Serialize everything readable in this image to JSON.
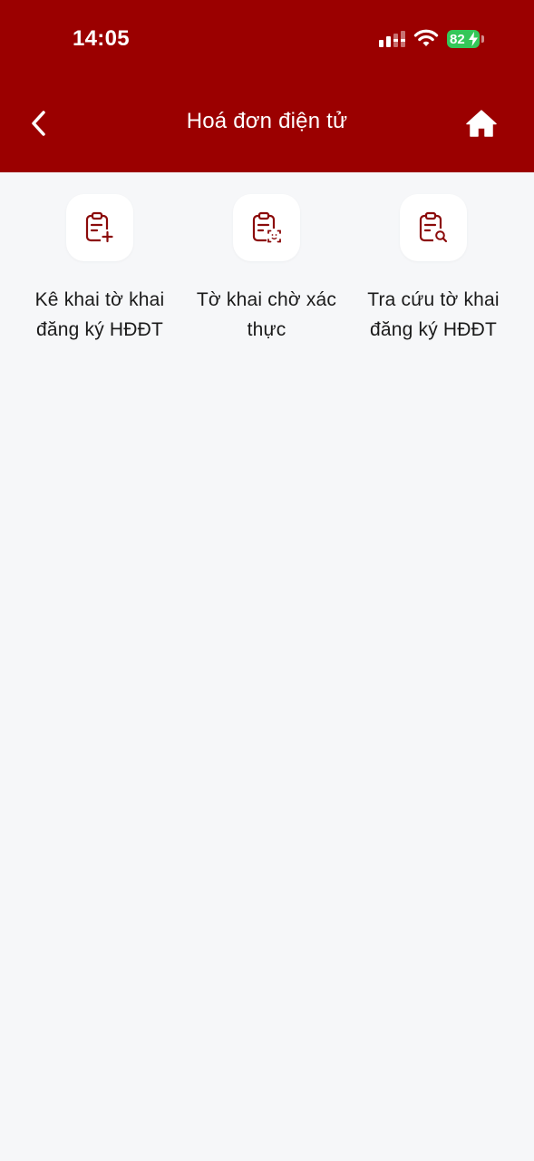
{
  "status_bar": {
    "time": "14:05",
    "battery_level": "82",
    "icons": [
      "signal-icon",
      "wifi-icon",
      "battery-icon"
    ]
  },
  "nav": {
    "title": "Hoá đơn điện tử",
    "back_icon": "chevron-left-icon",
    "home_icon": "home-icon"
  },
  "menu": [
    {
      "label_line1": "Kê khai tờ khai",
      "label_line2": "đăng ký HĐĐT",
      "icon": "clipboard-add-icon"
    },
    {
      "label_line1": "Tờ khai chờ xác",
      "label_line2": "thực",
      "icon": "clipboard-face-scan-icon"
    },
    {
      "label_line1": "Tra cứu tờ khai",
      "label_line2": "đăng ký HĐĐT",
      "icon": "clipboard-search-icon"
    }
  ],
  "colors": {
    "header_bg": "#9b0000",
    "icon_color": "#8b0a0a",
    "page_bg": "#f6f7f9",
    "battery": "#34c759"
  }
}
